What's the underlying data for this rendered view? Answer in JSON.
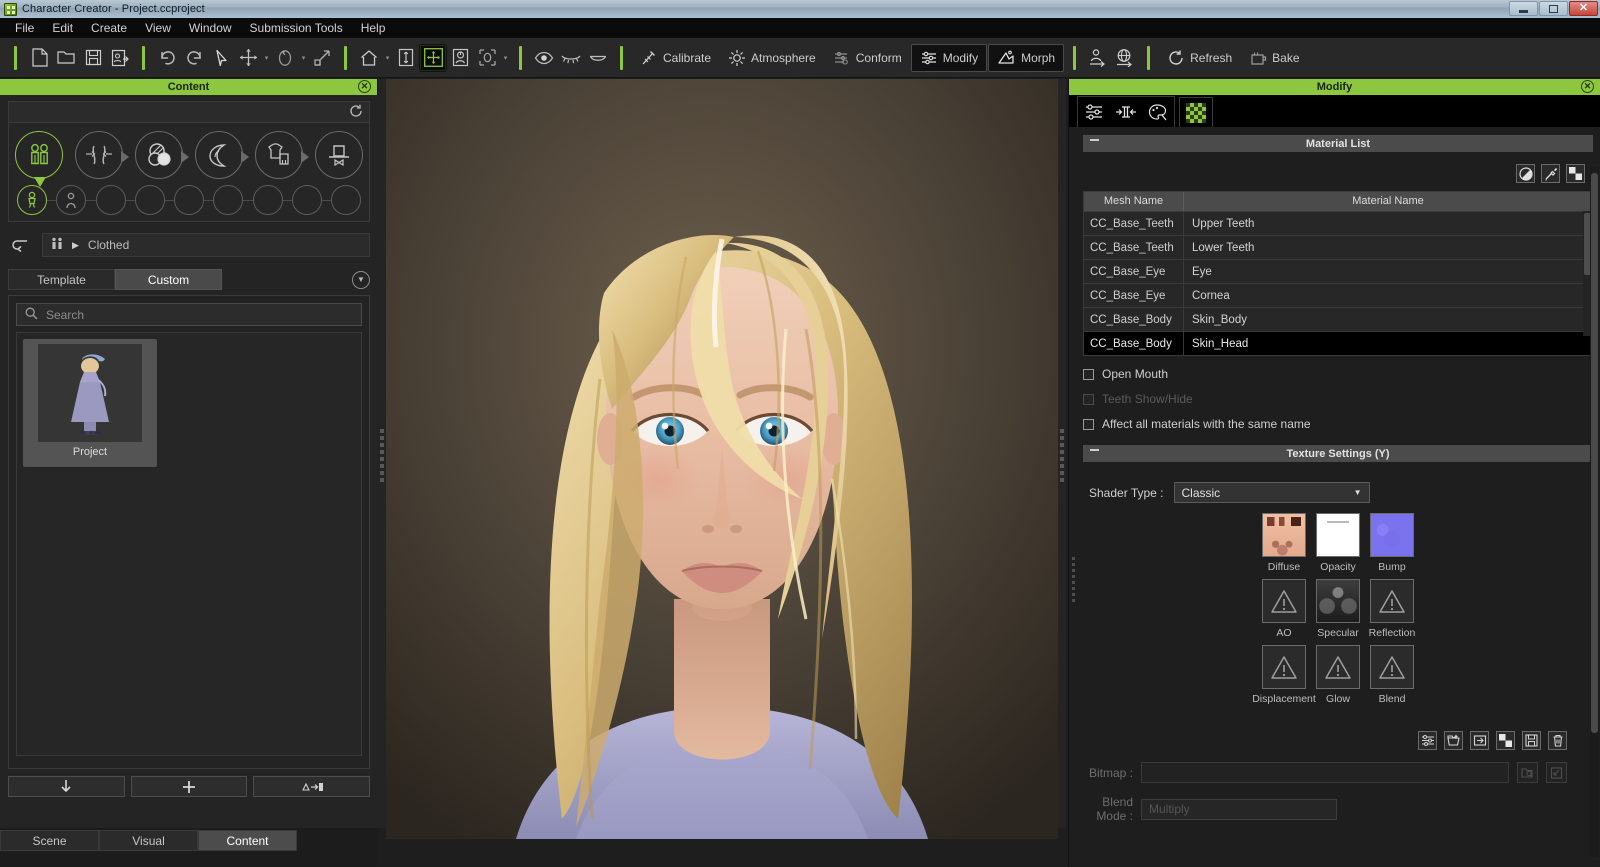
{
  "window": {
    "title": "Character Creator - Project.ccproject",
    "app_icon": "character-creator-icon",
    "minimize": "–",
    "maximize": "□",
    "close": "✕"
  },
  "menu": {
    "items": [
      "File",
      "Edit",
      "Create",
      "View",
      "Window",
      "Submission Tools",
      "Help"
    ]
  },
  "toolbar": {
    "groups": [
      {
        "icons": [
          "new-file-icon",
          "open-folder-icon",
          "save-icon",
          "save-as-icon"
        ]
      },
      {
        "icons": [
          "undo-icon",
          "redo-icon",
          "select-arrow-icon",
          "move-icon",
          "rotate-icon",
          "scale-icon"
        ]
      },
      {
        "icons": [
          "home-view-icon",
          "height-adjust-icon",
          "transform-gizmo-icon",
          "pose-icon",
          "bounding-box-icon"
        ]
      },
      {
        "icons": [
          "eye-icon",
          "eyelash-icon",
          "mouth-icon"
        ]
      }
    ],
    "calibrate_label": "Calibrate",
    "atmosphere_label": "Atmosphere",
    "conform_label": "Conform",
    "modify_label": "Modify",
    "morph_label": "Morph",
    "refresh_label": "Refresh",
    "bake_label": "Bake",
    "avatar_icons": [
      "person-export-icon",
      "globe-export-icon"
    ]
  },
  "left_panel": {
    "title": "Content",
    "close_icon": "close-icon",
    "reload_icon": "reload-icon",
    "nav_bubbles": [
      {
        "name": "bubble-character",
        "icon": "two-people-icon",
        "selected": true
      },
      {
        "name": "bubble-morph",
        "icon": "arrows-inward-icon",
        "selected": false
      },
      {
        "name": "bubble-skin",
        "icon": "palette-spheres-icon",
        "selected": false
      },
      {
        "name": "bubble-head",
        "icon": "head-profile-icon",
        "selected": false
      },
      {
        "name": "bubble-cloth",
        "icon": "clothing-icon",
        "selected": false
      },
      {
        "name": "bubble-accessory",
        "icon": "hat-icon",
        "selected": false
      }
    ],
    "nav_dots": [
      {
        "name": "dot-clothed",
        "icon": "clothed-figure-icon",
        "selected": true
      },
      {
        "name": "dot-nude",
        "icon": "figure-icon",
        "selected": false
      },
      {
        "name": "dot-3",
        "icon": "",
        "selected": false
      },
      {
        "name": "dot-4",
        "icon": "",
        "selected": false
      },
      {
        "name": "dot-5",
        "icon": "",
        "selected": false
      },
      {
        "name": "dot-6",
        "icon": "",
        "selected": false
      },
      {
        "name": "dot-7",
        "icon": "",
        "selected": false
      },
      {
        "name": "dot-8",
        "icon": "",
        "selected": false
      },
      {
        "name": "dot-9",
        "icon": "",
        "selected": false
      }
    ],
    "back_icon": "back-arrow-icon",
    "breadcrumb": {
      "icon": "people-icon",
      "arrow": "▶",
      "label": "Clothed"
    },
    "tabs": [
      {
        "label": "Template",
        "active": false
      },
      {
        "label": "Custom",
        "active": true
      }
    ],
    "expand_icon": "chevron-down-icon",
    "search": {
      "icon": "search-icon",
      "placeholder": "Search",
      "value": ""
    },
    "items": [
      {
        "caption": "Project",
        "thumbnail": "character-in-purple-dress"
      }
    ],
    "action_buttons": [
      {
        "name": "download-button",
        "glyph": "⬇"
      },
      {
        "name": "add-button",
        "glyph": "✚"
      },
      {
        "name": "apply-button",
        "glyph": "Δ➞▮"
      }
    ],
    "bottom_tabs": [
      {
        "label": "Scene",
        "active": false
      },
      {
        "label": "Visual",
        "active": false
      },
      {
        "label": "Content",
        "active": true
      }
    ]
  },
  "right_panel": {
    "title": "Modify",
    "close_icon": "close-icon",
    "tabs": [
      {
        "name": "tab-attribute",
        "icon": "sliders-icon",
        "active": false
      },
      {
        "name": "tab-mesh",
        "icon": "mesh-collapse-icon",
        "active": false
      },
      {
        "name": "tab-appearance",
        "icon": "palette-icon",
        "active": false
      },
      {
        "name": "tab-material",
        "icon": "checker-icon",
        "active": true
      }
    ],
    "material_list": {
      "header": "Material List",
      "collapse_icon": "collapse-minus-icon",
      "tool_icons": [
        {
          "name": "opacity-circle-icon"
        },
        {
          "name": "eyedropper-icon"
        },
        {
          "name": "checker-swatch-icon"
        }
      ],
      "columns": [
        "Mesh Name",
        "Material Name"
      ],
      "rows": [
        {
          "mesh": "CC_Base_Teeth",
          "material": "Upper Teeth",
          "selected": false
        },
        {
          "mesh": "CC_Base_Teeth",
          "material": "Lower Teeth",
          "selected": false
        },
        {
          "mesh": "CC_Base_Eye",
          "material": "Eye",
          "selected": false
        },
        {
          "mesh": "CC_Base_Eye",
          "material": "Cornea",
          "selected": false
        },
        {
          "mesh": "CC_Base_Body",
          "material": "Skin_Body",
          "selected": false
        },
        {
          "mesh": "CC_Base_Body",
          "material": "Skin_Head",
          "selected": true
        }
      ],
      "checkboxes": [
        {
          "label": "Open Mouth",
          "checked": false,
          "disabled": false
        },
        {
          "label": "Teeth Show/Hide",
          "checked": false,
          "disabled": true
        },
        {
          "label": "Affect all materials with the same name",
          "checked": false,
          "disabled": false
        }
      ]
    },
    "texture_settings": {
      "header": "Texture Settings  (Y)",
      "collapse_icon": "collapse-minus-icon",
      "shader_label": "Shader Type :",
      "shader_value": "Classic",
      "dropdown_icon": "chevron-down-icon",
      "slots": [
        {
          "label": "Diffuse",
          "state": "loaded",
          "preview": "skin-diffuse"
        },
        {
          "label": "Opacity",
          "state": "loaded",
          "preview": "white-opacity"
        },
        {
          "label": "Bump",
          "state": "loaded",
          "preview": "blue-bump"
        },
        {
          "label": "AO",
          "state": "empty",
          "preview": "warning-icon"
        },
        {
          "label": "Specular",
          "state": "loaded",
          "preview": "gray-specular"
        },
        {
          "label": "Reflection",
          "state": "empty",
          "preview": "warning-icon"
        },
        {
          "label": "Displacement",
          "state": "empty",
          "preview": "warning-icon"
        },
        {
          "label": "Glow",
          "state": "empty",
          "preview": "warning-icon"
        },
        {
          "label": "Blend",
          "state": "empty",
          "preview": "warning-icon"
        }
      ],
      "bottom_icons": [
        {
          "name": "texture-settings-icon"
        },
        {
          "name": "load-texture-icon"
        },
        {
          "name": "add-to-slot-icon"
        },
        {
          "name": "checker-icon"
        },
        {
          "name": "save-texture-icon"
        },
        {
          "name": "delete-texture-icon"
        }
      ],
      "bitmap_label": "Bitmap :",
      "bitmap_value": "",
      "bitmap_buttons": [
        {
          "name": "browse-bitmap-icon"
        },
        {
          "name": "open-external-icon"
        }
      ],
      "blend_mode_label": "Blend Mode :",
      "blend_mode_value": "Multiply"
    }
  },
  "colors": {
    "accent_green": "#8dc63f",
    "panel_bg": "#242424",
    "panel_dark": "#1e1e1e",
    "section_header": "#4b4b4b",
    "selected_row": "#000000",
    "viewport_bg": "#4a4136"
  }
}
